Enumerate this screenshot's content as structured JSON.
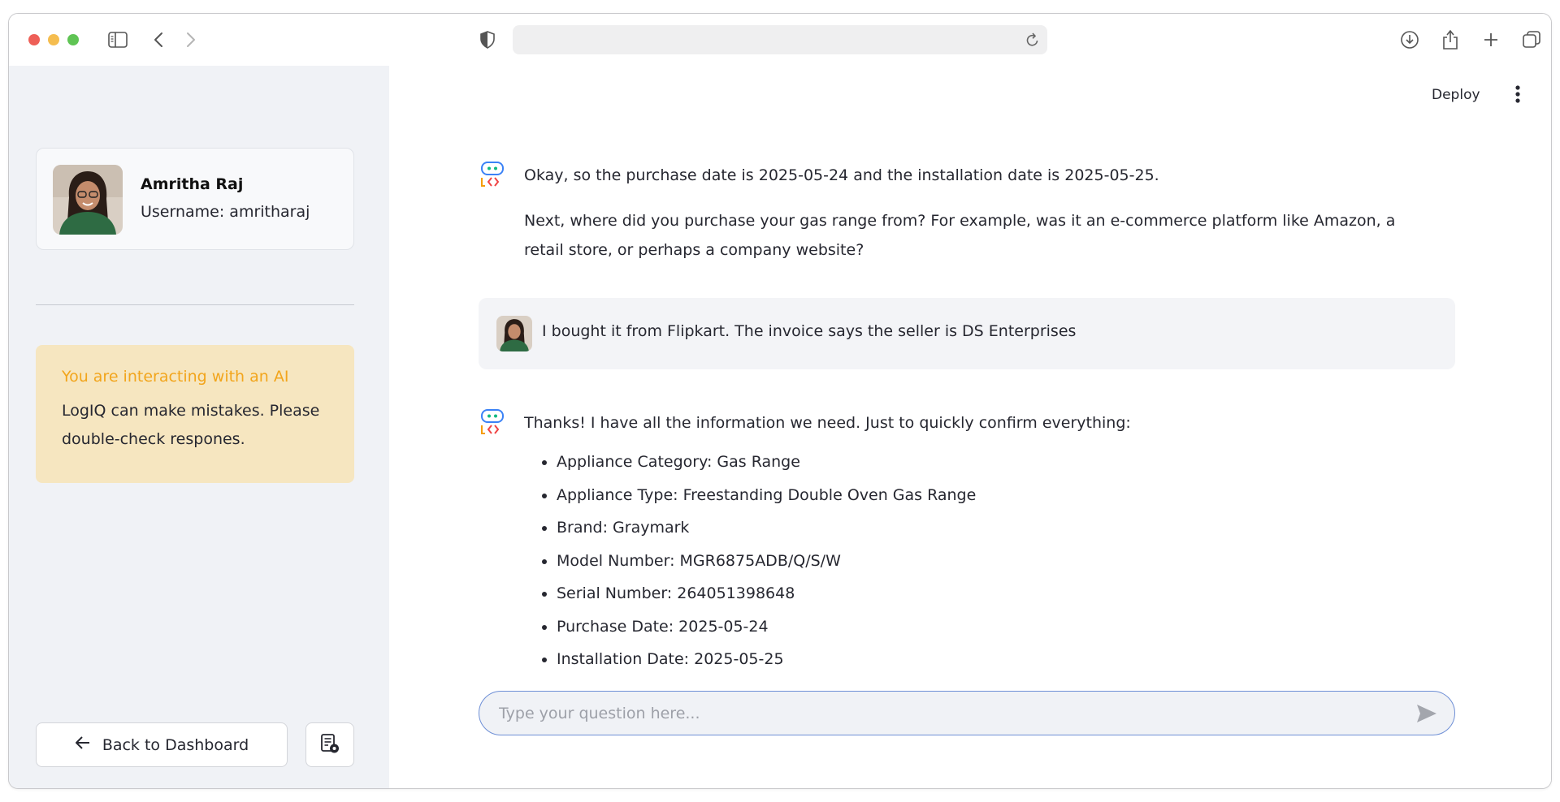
{
  "sidebar": {
    "user": {
      "name": "Amritha Raj",
      "username": "Username: amritharaj"
    },
    "warning": {
      "title": "You are interacting with an AI",
      "text": "LogIQ can make mistakes. Please double-check respones."
    },
    "back_button_label": "Back to Dashboard"
  },
  "header": {
    "deploy_label": "Deploy"
  },
  "chat": {
    "messages": [
      {
        "role": "assistant",
        "paragraphs": [
          "Okay, so the purchase date is 2025-05-24 and the installation date is 2025-05-25.",
          "Next, where did you purchase your gas range from? For example, was it an e-commerce platform like Amazon, a retail store, or perhaps a company website?"
        ]
      },
      {
        "role": "user",
        "text": "I bought it from Flipkart. The invoice says the seller is DS Enterprises"
      },
      {
        "role": "assistant",
        "intro": "Thanks! I have all the information we need. Just to quickly confirm everything:",
        "items": [
          "Appliance Category: Gas Range",
          "Appliance Type: Freestanding Double Oven Gas Range",
          "Brand: Graymark",
          "Model Number: MGR6875ADB/Q/S/W",
          "Serial Number: 264051398648",
          "Purchase Date: 2025-05-24",
          "Installation Date: 2025-05-25"
        ]
      }
    ],
    "input": {
      "placeholder": "Type your question here...",
      "value": ""
    }
  },
  "colors": {
    "sidebar_bg": "#f0f2f6",
    "warning_bg": "#f6e6c0",
    "warning_title": "#f2a51c",
    "input_border": "#6e8fd6"
  }
}
